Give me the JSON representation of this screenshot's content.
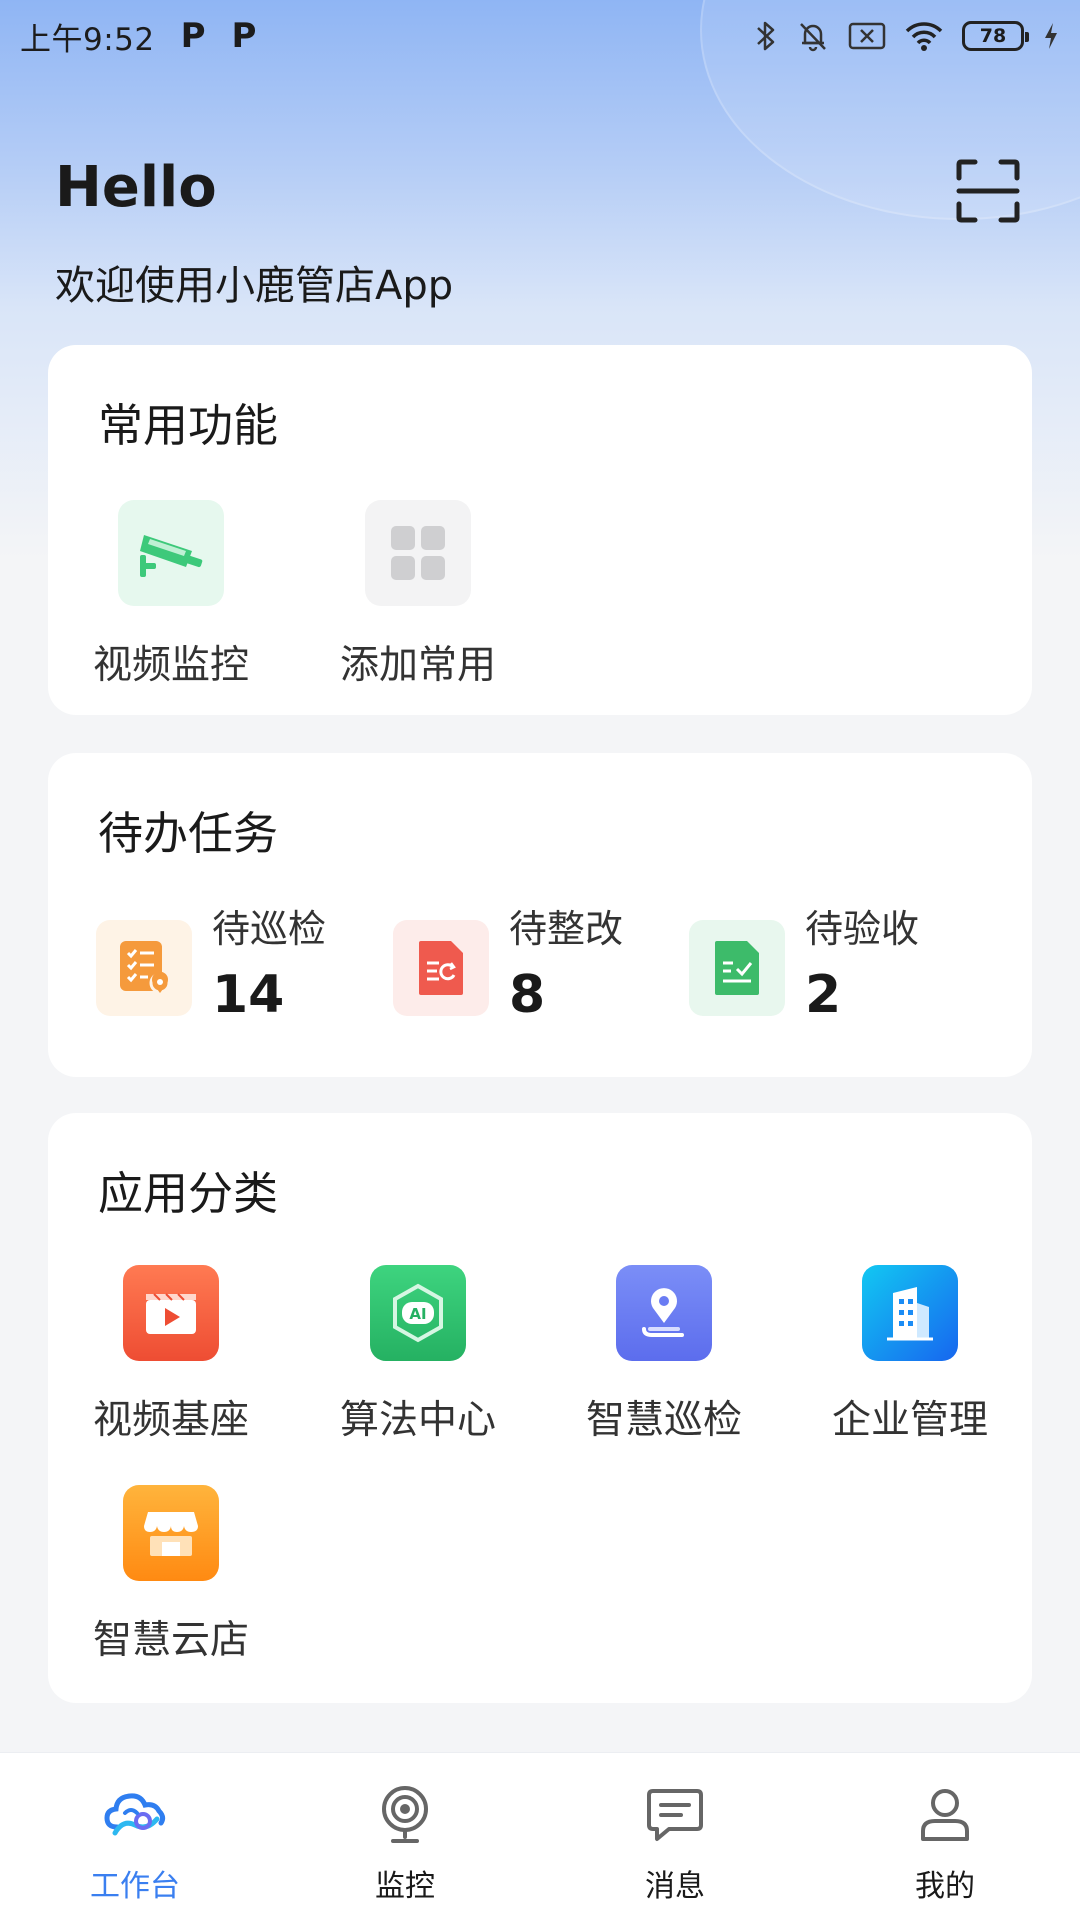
{
  "status_bar": {
    "time": "上午9:52",
    "notif_1": "P",
    "notif_2": "P",
    "battery": "78"
  },
  "header": {
    "greeting": "Hello",
    "welcome": "欢迎使用小鹿管店App",
    "scan_icon": "scan-icon"
  },
  "common": {
    "title": "常用功能",
    "items": [
      {
        "label": "视频监控",
        "icon": "camera-icon",
        "color": "#3dc97a"
      },
      {
        "label": "添加常用",
        "icon": "grid-icon",
        "color": "#cccccc"
      }
    ]
  },
  "todo": {
    "title": "待办任务",
    "items": [
      {
        "label": "待巡检",
        "count": "14",
        "icon": "checklist-icon",
        "color": "#f59a3c"
      },
      {
        "label": "待整改",
        "count": "8",
        "icon": "rectify-doc-icon",
        "color": "#ef5a4e"
      },
      {
        "label": "待验收",
        "count": "2",
        "icon": "accept-doc-icon",
        "color": "#3dbb6a"
      }
    ]
  },
  "apps": {
    "title": "应用分类",
    "items": [
      {
        "label": "视频基座",
        "icon": "video-clapper-icon",
        "color": "#f25b3a"
      },
      {
        "label": "算法中心",
        "icon": "ai-icon",
        "color": "#2fc06f"
      },
      {
        "label": "智慧巡检",
        "icon": "location-pin-icon",
        "color": "#6a7cf3"
      },
      {
        "label": "企业管理",
        "icon": "building-icon",
        "color": "#1b8cf5"
      },
      {
        "label": "智慧云店",
        "icon": "store-icon",
        "color": "#ff9a1f"
      }
    ]
  },
  "tabbar": {
    "items": [
      {
        "label": "工作台",
        "icon": "workbench-cloud-icon",
        "active": true
      },
      {
        "label": "监控",
        "icon": "webcam-icon"
      },
      {
        "label": "消息",
        "icon": "message-icon"
      },
      {
        "label": "我的",
        "icon": "profile-icon"
      }
    ],
    "active_color": "#3a7ff0"
  }
}
